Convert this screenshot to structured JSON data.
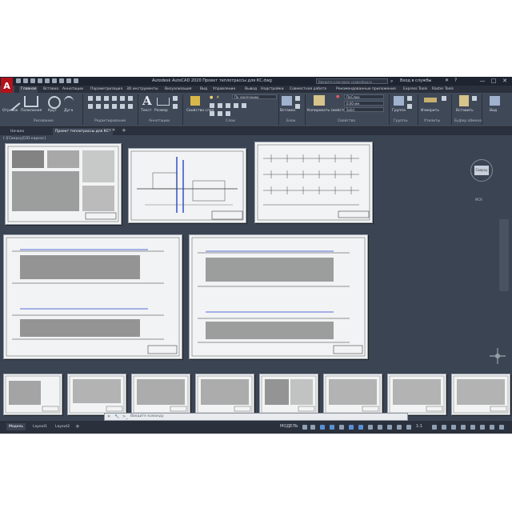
{
  "titlebar": {
    "logo": "A",
    "title": "Autodesk AutoCAD 2020   Проект теплотрассы для КС.dwg",
    "search_placeholder": "Введите ключевое слово/фразу",
    "signin": "Вход в службы",
    "minimize": "—",
    "maximize": "□",
    "close": "✕"
  },
  "tabs": [
    "Главная",
    "Вставка",
    "Аннотации",
    "Параметризация",
    "3D инструменты",
    "Визуализация",
    "Вид",
    "Управление",
    "Вывод",
    "Надстройки",
    "Совместная работа",
    "Рекомендованные приложения",
    "Express Tools",
    "Raster Tools"
  ],
  "ribbon": {
    "draw": {
      "line": "Отрезок",
      "polyline": "Полилиния",
      "circle": "Круг",
      "arc": "Дуга",
      "panel": "Рисование"
    },
    "modify": {
      "panel": "Редактирование"
    },
    "annotation": {
      "text": "Текст",
      "dimension": "Размер",
      "panel": "Аннотации"
    },
    "layers": {
      "props": "Свойства слоя",
      "layer_value": "По умолчанию",
      "panel": "Слои"
    },
    "block": {
      "insert": "Вставка",
      "panel": "Блок"
    },
    "properties": {
      "match": "Копировать свойства",
      "color": "ПоСлою",
      "lineweight": "0,00 мм",
      "linetype": "Solid",
      "panel": "Свойства"
    },
    "groups": {
      "group": "Группа",
      "panel": "Группы"
    },
    "utilities": {
      "measure": "Измерить",
      "panel": "Утилиты"
    },
    "clipboard": {
      "paste": "Вставить",
      "panel": "Буфер обмена"
    },
    "view": {
      "base": "Вид"
    }
  },
  "doctabs": [
    "Начало",
    "Проект теплотрассы для КС*"
  ],
  "canvas": {
    "viewlabel": "[-][Сверху][2D каркас]",
    "viewcube": "Сверху",
    "wcs": "МСК"
  },
  "cmdline": {
    "placeholder": "Введите команду"
  },
  "status": {
    "layouts": [
      "Модель",
      "Layout1",
      "Layout2"
    ],
    "model": "МОДЕЛЬ",
    "scale": "1:1"
  }
}
